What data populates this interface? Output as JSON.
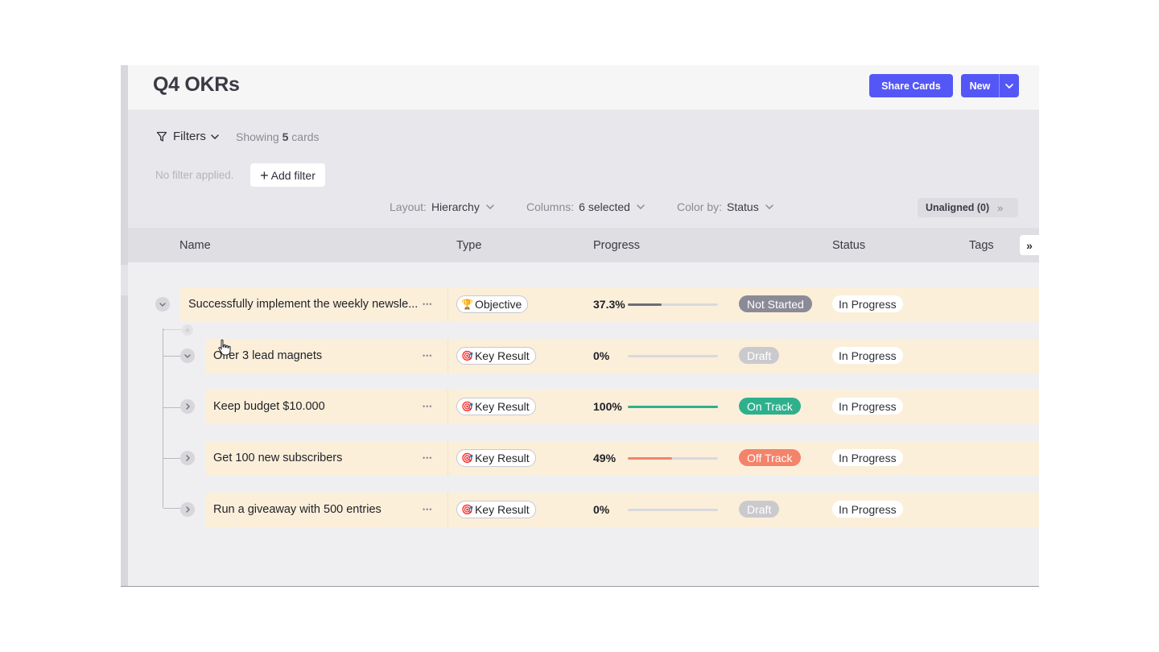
{
  "page": {
    "title": "Q4 OKRs"
  },
  "header": {
    "share_label": "Share Cards",
    "new_label": "New"
  },
  "filters": {
    "label": "Filters",
    "showing_prefix": "Showing",
    "showing_count": "5",
    "showing_suffix": "cards",
    "no_filter": "No filter applied.",
    "add_filter": "Add filter"
  },
  "options": {
    "layout_label": "Layout:",
    "layout_value": "Hierarchy",
    "columns_label": "Columns:",
    "columns_value": "6 selected",
    "color_label": "Color by:",
    "color_value": "Status",
    "unaligned": "Unaligned (0)"
  },
  "columns": [
    "Name",
    "Type",
    "Progress",
    "Status",
    "Tags"
  ],
  "colors": {
    "accent": "#5457f5",
    "not_started": "#8a8b96",
    "draft": "#cacace",
    "on_track": "#2fb08c",
    "off_track": "#f3836a",
    "row_bg": "#fbefda"
  },
  "rows": [
    {
      "name": "Successfully implement the weekly newsle...",
      "type": "Objective",
      "type_icon": "trophy-icon",
      "progress_label": "37.3%",
      "progress": 0.373,
      "status": "Not Started",
      "status_color": "#8a8b96",
      "state": "In Progress",
      "expanded": true
    },
    {
      "name": "Offer 3 lead magnets",
      "type": "Key Result",
      "type_icon": "target-icon",
      "progress_label": "0%",
      "progress": 0,
      "status": "Draft",
      "status_color": "#cacace",
      "state": "In Progress",
      "expanded": true
    },
    {
      "name": "Keep budget $10.000",
      "type": "Key Result",
      "type_icon": "target-icon",
      "progress_label": "100%",
      "progress": 1.0,
      "status": "On Track",
      "status_color": "#2fb08c",
      "state": "In Progress",
      "expanded": false
    },
    {
      "name": "Get 100 new subscribers",
      "type": "Key Result",
      "type_icon": "target-icon",
      "progress_label": "49%",
      "progress": 0.49,
      "status": "Off Track",
      "status_color": "#f3836a",
      "state": "In Progress",
      "expanded": false
    },
    {
      "name": "Run a giveaway with 500 entries",
      "type": "Key Result",
      "type_icon": "target-icon",
      "progress_label": "0%",
      "progress": 0,
      "status": "Draft",
      "status_color": "#cacace",
      "state": "In Progress",
      "expanded": false
    }
  ]
}
